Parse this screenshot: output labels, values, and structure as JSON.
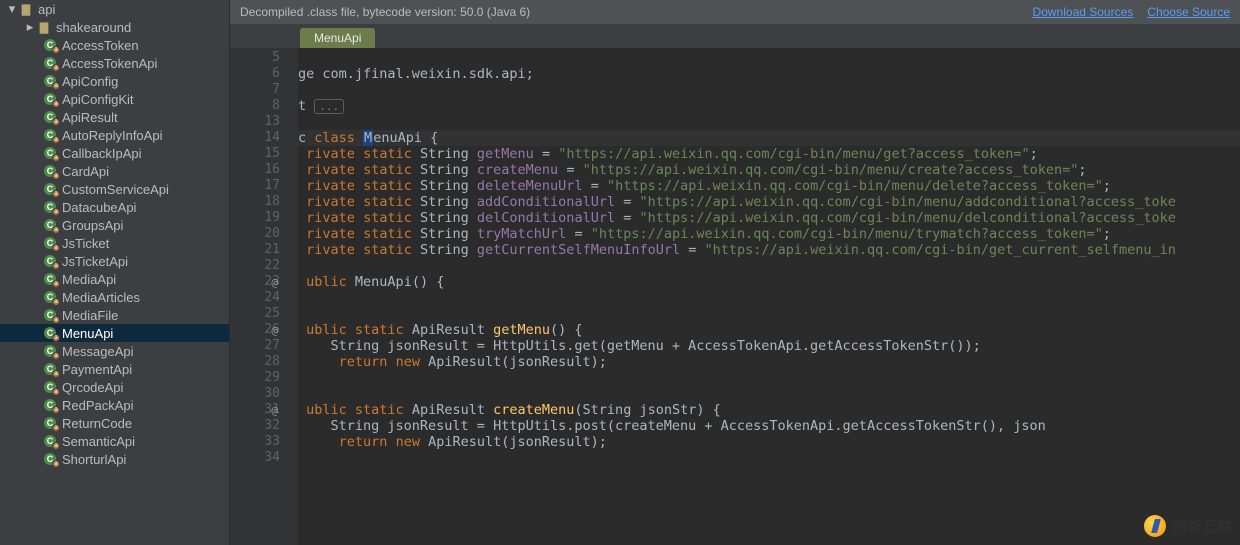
{
  "sidebar": {
    "root": {
      "label": "api",
      "expanded": true
    },
    "folder": {
      "label": "shakearound",
      "expanded": false
    },
    "classes": [
      "AccessToken",
      "AccessTokenApi",
      "ApiConfig",
      "ApiConfigKit",
      "ApiResult",
      "AutoReplyInfoApi",
      "CallbackIpApi",
      "CardApi",
      "CustomServiceApi",
      "DatacubeApi",
      "GroupsApi",
      "JsTicket",
      "JsTicketApi",
      "MediaApi",
      "MediaArticles",
      "MediaFile",
      "MenuApi",
      "MessageApi",
      "PaymentApi",
      "QrcodeApi",
      "RedPackApi",
      "ReturnCode",
      "SemanticApi",
      "ShorturlApi"
    ],
    "selected": "MenuApi"
  },
  "banner": {
    "text": "Decompiled .class file, bytecode version: 50.0 (Java 6)",
    "link1": "Download Sources",
    "link2": "Choose Source"
  },
  "tab": {
    "label": "MenuApi"
  },
  "gutter": {
    "lines": [
      5,
      6,
      7,
      8,
      13,
      14,
      15,
      16,
      17,
      18,
      19,
      20,
      21,
      22,
      23,
      24,
      25,
      26,
      27,
      28,
      29,
      30,
      31,
      32,
      33,
      34
    ],
    "markers": {
      "23": "@",
      "26": "@",
      "31": "@"
    }
  },
  "chart_data": {
    "type": "code",
    "language": "java",
    "package": "com.jfinal.weixin.sdk.api",
    "class": "MenuApi",
    "fields": [
      {
        "name": "getMenu",
        "value": "https://api.weixin.qq.com/cgi-bin/menu/get?access_token="
      },
      {
        "name": "createMenu",
        "value": "https://api.weixin.qq.com/cgi-bin/menu/create?access_token="
      },
      {
        "name": "deleteMenuUrl",
        "value": "https://api.weixin.qq.com/cgi-bin/menu/delete?access_token="
      },
      {
        "name": "addConditionalUrl",
        "value": "https://api.weixin.qq.com/cgi-bin/menu/addconditional?access_token="
      },
      {
        "name": "delConditionalUrl",
        "value": "https://api.weixin.qq.com/cgi-bin/menu/delconditional?access_token="
      },
      {
        "name": "tryMatchUrl",
        "value": "https://api.weixin.qq.com/cgi-bin/menu/trymatch?access_token="
      },
      {
        "name": "getCurrentSelfMenuInfoUrl",
        "value": "https://api.weixin.qq.com/cgi-bin/get_current_selfmenu_info?access_token="
      }
    ],
    "methods": [
      {
        "signature": "public MenuApi()"
      },
      {
        "signature": "public static ApiResult getMenu()",
        "body": [
          "String jsonResult = HttpUtils.get(getMenu + AccessTokenApi.getAccessTokenStr());",
          "return new ApiResult(jsonResult);"
        ]
      },
      {
        "signature": "public static ApiResult createMenu(String jsonStr)",
        "body": [
          "String jsonResult = HttpUtils.post(createMenu + AccessTokenApi.getAccessTokenStr(), jsonStr);",
          "return new ApiResult(jsonResult);"
        ]
      }
    ]
  },
  "code": {
    "pkg_prefix": "ge ",
    "pkg": "com.jfinal.weixin.sdk.api",
    "import_fold_prefix": "t ",
    "import_fold": "...",
    "class_decl_pre": "c ",
    "class_kw": "class",
    "class_name": "MenuApi",
    "priv": "rivate",
    "stat": "static",
    "String": "String",
    "fields": [
      {
        "name": "getMenu",
        "val": "\"https://api.weixin.qq.com/cgi-bin/menu/get?access_token=\"",
        "tail": ";"
      },
      {
        "name": "createMenu",
        "val": "\"https://api.weixin.qq.com/cgi-bin/menu/create?access_token=\"",
        "tail": ";"
      },
      {
        "name": "deleteMenuUrl",
        "val": "\"https://api.weixin.qq.com/cgi-bin/menu/delete?access_token=\"",
        "tail": ";"
      },
      {
        "name": "addConditionalUrl",
        "val": "\"https://api.weixin.qq.com/cgi-bin/menu/addconditional?access_toke",
        "tail": ""
      },
      {
        "name": "delConditionalUrl",
        "val": "\"https://api.weixin.qq.com/cgi-bin/menu/delconditional?access_toke",
        "tail": ""
      },
      {
        "name": "tryMatchUrl",
        "val": "\"https://api.weixin.qq.com/cgi-bin/menu/trymatch?access_token=\"",
        "tail": ";"
      },
      {
        "name": "getCurrentSelfMenuInfoUrl",
        "val": "\"https://api.weixin.qq.com/cgi-bin/get_current_selfmenu_in",
        "tail": ""
      }
    ],
    "pub": "ublic",
    "ctor": "MenuApi() {",
    "ret_type": "ApiResult",
    "m1_name": "getMenu",
    "m1_l1a": "    String jsonResult = HttpUtils.get(getMenu + AccessTokenApi.getAccessTokenStr());",
    "ret_kw": "return",
    "new_kw": "new",
    "ret_line": " ApiResult(jsonResult);",
    "m2_name": "createMenu",
    "m2_sig_tail": "(String jsonStr) {",
    "m2_l1": "    String jsonResult = HttpUtils.post(createMenu + AccessTokenApi.getAccessTokenStr(), json"
  },
  "watermark": {
    "text": "创新互联"
  }
}
